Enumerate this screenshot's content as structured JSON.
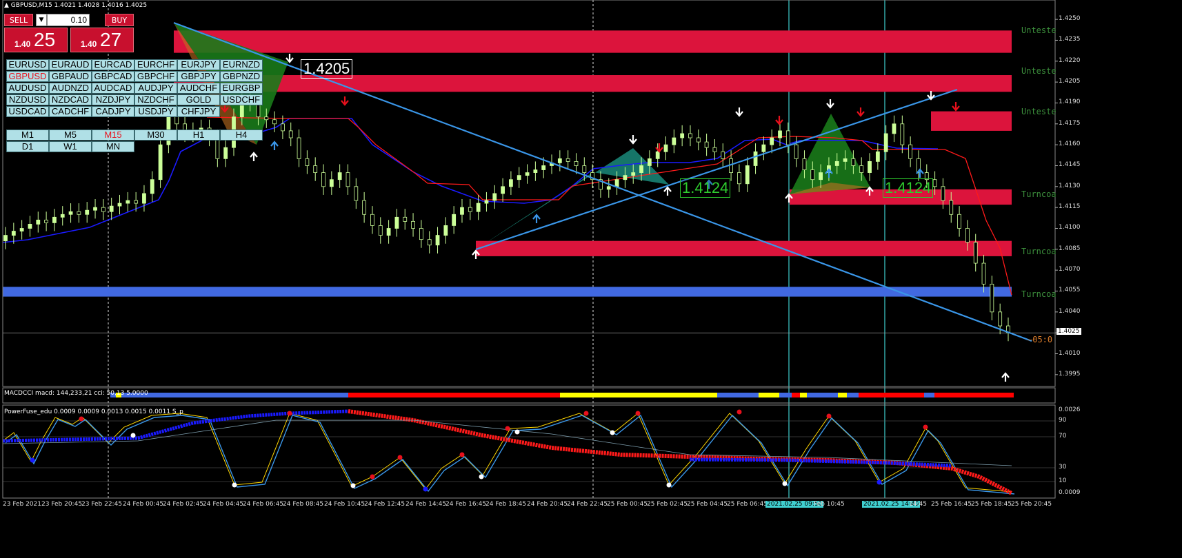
{
  "header": {
    "symbol_line": "GBPUSD,M15  1.4021 1.4028 1.4016 1.4025"
  },
  "trade_panel": {
    "sell_label": "SELL",
    "buy_label": "BUY",
    "lot_value": "0.10",
    "sell_small": "1.40",
    "sell_big": "25",
    "buy_small": "1.40",
    "buy_big": "27"
  },
  "symbols": [
    [
      "EURUSD",
      "EURAUD",
      "EURCAD",
      "EURCHF",
      "EURJPY",
      "EURNZD"
    ],
    [
      "GBPUSD",
      "GBPAUD",
      "GBPCAD",
      "GBPCHF",
      "GBPJPY",
      "GBPNZD"
    ],
    [
      "AUDUSD",
      "AUDNZD",
      "AUDCAD",
      "AUDJPY",
      "AUDCHF",
      "EURGBP"
    ],
    [
      "NZDUSD",
      "NZDCAD",
      "NZDJPY",
      "NZDCHF",
      "GOLD",
      "USDCHF"
    ],
    [
      "USDCAD",
      "CADCHF",
      "CADJPY",
      "USDJPY",
      "CHFJPY"
    ]
  ],
  "active_symbol": "GBPUSD",
  "timeframes": [
    [
      "M1",
      "M5",
      "M15",
      "M30",
      "H1",
      "H4"
    ],
    [
      "D1",
      "W1",
      "MN"
    ]
  ],
  "active_timeframe": "M15",
  "zone_labels": [
    "Unteste",
    "Unteste",
    "Unteste",
    "Turncoa",
    "Turncoa",
    "Turncoa"
  ],
  "price_labels": {
    "high": "1.4205",
    "mid1": "1.4124",
    "mid2": "1.4124",
    "countdown": "05:0",
    "current": "1.4025"
  },
  "indicator1_label": "MACDCCI macd: 144,233,21 cci: 50,13 5.0000",
  "indicator2_label": "PowerFuse_edu 0.0009 0.0009 0.0013 0.0015 0.0011  S_p",
  "indicator2_axis": [
    "0.0026",
    "90",
    "70",
    "30",
    "10",
    "0.0009"
  ],
  "time_labels": [
    "23 Feb 2021",
    "23 Feb 20:45",
    "23 Feb 22:45",
    "24 Feb 00:45",
    "24 Feb 02:45",
    "24 Feb 04:45",
    "24 Feb 06:45",
    "24 Feb 08:45",
    "24 Feb 10:45",
    "24 Feb 12:45",
    "24 Feb 14:45",
    "24 Feb 16:45",
    "24 Feb 18:45",
    "24 Feb 20:45",
    "24 Feb 22:45",
    "25 Feb 00:45",
    "25 Feb 02:45",
    "25 Feb 04:45",
    "25 Feb 06:45",
    "2021.02.25 09:50",
    "Feb 10:45",
    "2021.02.25 14:40",
    "14:45",
    "25 Feb 16:45",
    "25 Feb 18:45",
    "25 Feb 20:45"
  ],
  "colors": {
    "zone_red": "#dc143c",
    "zone_blue": "#4169e1",
    "trendline": "#3a96e8",
    "channel_blue": "#1a1aff",
    "channel_red": "#ff1a1a",
    "candle": "#ccff99",
    "vline": "#40d0d0",
    "harmonic_green": "#1a7a1a",
    "harmonic_teal": "#1a8a7a"
  },
  "chart_data": {
    "type": "candlestick",
    "symbol": "GBPUSD",
    "timeframe": "M15",
    "ylim": [
      1.3988,
      1.4255
    ],
    "y_ticks": [
      1.425,
      1.4235,
      1.422,
      1.4205,
      1.419,
      1.4175,
      1.416,
      1.4145,
      1.413,
      1.4115,
      1.41,
      1.4085,
      1.407,
      1.4055,
      1.404,
      1.4025,
      1.401,
      1.3995
    ],
    "ohlc_last": {
      "open": 1.4021,
      "high": 1.4028,
      "low": 1.4016,
      "close": 1.4025
    },
    "supply_demand_zones": [
      {
        "from": 1.4226,
        "to": 1.4242,
        "color": "red",
        "label": "Unteste"
      },
      {
        "from": 1.4198,
        "to": 1.421,
        "color": "red",
        "label": "Unteste"
      },
      {
        "from": 1.417,
        "to": 1.4184,
        "color": "red",
        "label": "Unteste"
      },
      {
        "from": 1.4117,
        "to": 1.4128,
        "color": "red",
        "label": "Turncoa"
      },
      {
        "from": 1.408,
        "to": 1.4091,
        "color": "red",
        "label": "Turncoa"
      },
      {
        "from": 1.4051,
        "to": 1.4058,
        "color": "blue",
        "label": "Turncoa"
      }
    ],
    "candles_close": [
      1.4095,
      1.4098,
      1.41,
      1.4103,
      1.4106,
      1.4104,
      1.4108,
      1.411,
      1.4112,
      1.411,
      1.4113,
      1.4115,
      1.4112,
      1.4116,
      1.4118,
      1.412,
      1.4118,
      1.4125,
      1.4135,
      1.416,
      1.4185,
      1.4175,
      1.4168,
      1.417,
      1.4172,
      1.4165,
      1.415,
      1.4158,
      1.418,
      1.4195,
      1.419,
      1.418,
      1.4178,
      1.4175,
      1.417,
      1.4165,
      1.415,
      1.4145,
      1.414,
      1.413,
      1.4135,
      1.414,
      1.413,
      1.412,
      1.411,
      1.4102,
      1.4095,
      1.41,
      1.4108,
      1.4105,
      1.41,
      1.4092,
      1.4088,
      1.4095,
      1.4102,
      1.411,
      1.4115,
      1.4112,
      1.4118,
      1.412,
      1.4125,
      1.413,
      1.4135,
      1.4138,
      1.414,
      1.4142,
      1.4145,
      1.4147,
      1.415,
      1.4148,
      1.4145,
      1.414,
      1.4135,
      1.4128,
      1.413,
      1.4135,
      1.4138,
      1.414,
      1.4145,
      1.415,
      1.4155,
      1.416,
      1.4165,
      1.4168,
      1.4165,
      1.4162,
      1.4158,
      1.4155,
      1.415,
      1.414,
      1.4132,
      1.4145,
      1.4155,
      1.416,
      1.4165,
      1.417,
      1.416,
      1.415,
      1.4142,
      1.4135,
      1.414,
      1.4145,
      1.4148,
      1.415,
      1.4145,
      1.414,
      1.4148,
      1.4155,
      1.4168,
      1.4175,
      1.416,
      1.415,
      1.414,
      1.4135,
      1.413,
      1.412,
      1.411,
      1.41,
      1.409,
      1.4075,
      1.406,
      1.404,
      1.403,
      1.4025
    ]
  }
}
